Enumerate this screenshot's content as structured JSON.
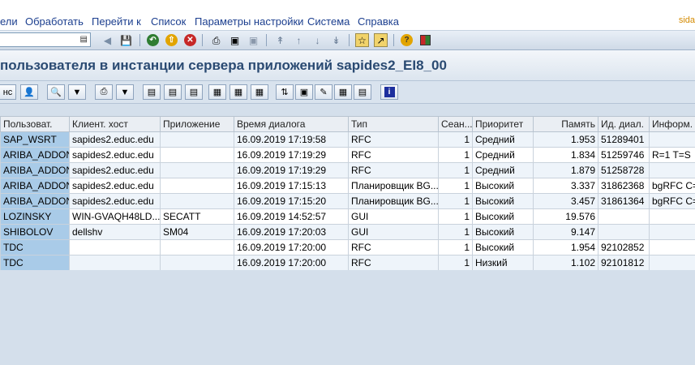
{
  "menu": {
    "items": [
      "ели",
      "Обработать",
      "Перейти к",
      "Список",
      "Параметры настройки",
      "Система",
      "Справка"
    ],
    "brand": "sida"
  },
  "toolbar": {
    "command_value": ""
  },
  "title": "пользователя в инстанции сервера приложений sapides2_EI8_00",
  "apptoolbar": {
    "first_label": "нс"
  },
  "table": {
    "headers": [
      "Пользоват.",
      "Клиент. хост",
      "Приложение",
      "Время диалога",
      "Тип",
      "Сеан...",
      "Приоритет",
      "Память",
      "Ид. диал.",
      "Информ."
    ],
    "rows": [
      [
        "SAP_WSRT",
        "sapides2.educ.edu",
        "",
        "16.09.2019 17:19:58",
        "RFC",
        "1",
        "Средний",
        "1.953",
        "51289401",
        ""
      ],
      [
        "ARIBA_ADDON",
        "sapides2.educ.edu",
        "",
        "16.09.2019 17:19:29",
        "RFC",
        "1",
        "Средний",
        "1.834",
        "51259746",
        "R=1 T=S"
      ],
      [
        "ARIBA_ADDON",
        "sapides2.educ.edu",
        "",
        "16.09.2019 17:19:29",
        "RFC",
        "1",
        "Средний",
        "1.879",
        "51258728",
        ""
      ],
      [
        "ARIBA_ADDON",
        "sapides2.educ.edu",
        "",
        "16.09.2019 17:15:13",
        "Планировщик BG...",
        "1",
        "Высокий",
        "3.337",
        "31862368",
        "bgRFC C="
      ],
      [
        "ARIBA_ADDON",
        "sapides2.educ.edu",
        "",
        "16.09.2019 17:15:20",
        "Планировщик BG...",
        "1",
        "Высокий",
        "3.457",
        "31861364",
        "bgRFC C="
      ],
      [
        "LOZINSKY",
        "WIN-GVAQH48LD...",
        "SECATT",
        "16.09.2019 14:52:57",
        "GUI",
        "1",
        "Высокий",
        "19.576",
        "",
        ""
      ],
      [
        "SHIBOLOV",
        "dellshv",
        "SM04",
        "16.09.2019 17:20:03",
        "GUI",
        "1",
        "Высокий",
        "9.147",
        "",
        ""
      ],
      [
        "TDC",
        "",
        "",
        "16.09.2019 17:20:00",
        "RFC",
        "1",
        "Высокий",
        "1.954",
        "92102852",
        ""
      ],
      [
        "TDC",
        "",
        "",
        "16.09.2019 17:20:00",
        "RFC",
        "1",
        "Низкий",
        "1.102",
        "92101812",
        ""
      ]
    ]
  },
  "colors": {
    "menu_text": "#1c3f8f",
    "title_text": "#2a4a72",
    "key_column": "#a9cbe8",
    "brand": "#d48a00"
  }
}
